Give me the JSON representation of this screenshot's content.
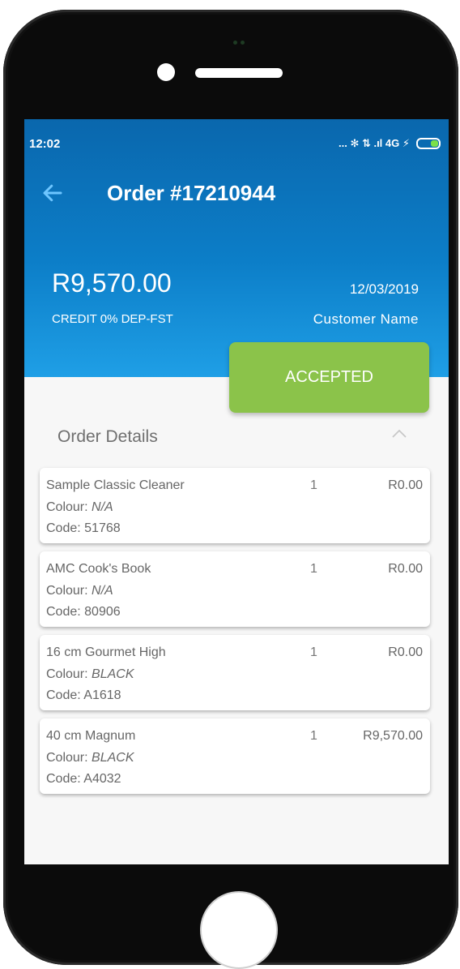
{
  "status_bar": {
    "time": "12:02",
    "indicators": "... ✻ ⇅ .ıl 4G ⚡",
    "battery_color": "#7be04a"
  },
  "header": {
    "title": "Order #17210944",
    "back_icon": "arrow-left-icon",
    "amount": "R9,570.00",
    "date": "12/03/2019",
    "payment_terms": "CREDIT 0% DEP-FST",
    "customer": "Customer Name",
    "gradient_top": "#0a67ad",
    "gradient_bottom": "#1f9fe6"
  },
  "status_button": {
    "label": "ACCEPTED",
    "color": "#8bc34a"
  },
  "details": {
    "title": "Order Details",
    "collapse_icon": "chevron-up-icon",
    "colour_prefix": "Colour: ",
    "code_prefix": "Code: ",
    "items": [
      {
        "name": "Sample Classic Cleaner",
        "colour": "N/A",
        "code": "51768",
        "qty": "1",
        "price": "R0.00"
      },
      {
        "name": "AMC Cook's Book",
        "colour": "N/A",
        "code": "80906",
        "qty": "1",
        "price": "R0.00"
      },
      {
        "name": "16 cm Gourmet High",
        "colour": "BLACK",
        "code": "A1618",
        "qty": "1",
        "price": "R0.00"
      },
      {
        "name": "40 cm Magnum",
        "colour": "BLACK",
        "code": "A4032",
        "qty": "1",
        "price": "R9,570.00"
      }
    ]
  }
}
